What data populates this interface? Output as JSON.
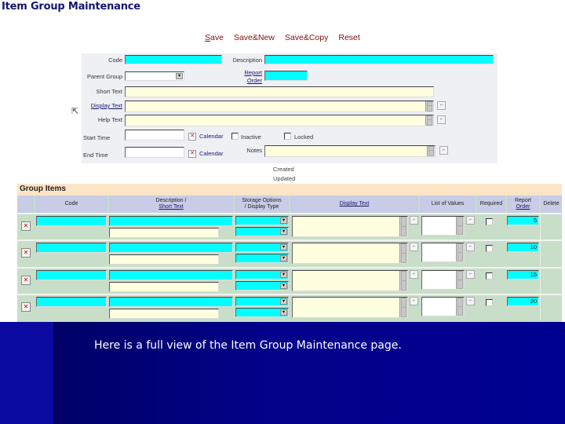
{
  "page": {
    "title": "Item Group Maintenance"
  },
  "toolbar": {
    "save": "Save",
    "save_new": "Save&New",
    "save_copy": "Save&Copy",
    "reset": "Reset"
  },
  "form": {
    "code_label": "Code",
    "code_value": "",
    "description_label": "Description",
    "description_value": "",
    "parent_group_label": "Parent Group",
    "parent_group_value": "",
    "report_order_label_1": "Report",
    "report_order_label_2": "Order",
    "report_order_value": "",
    "short_text_label": "Short Text",
    "short_text_value": "",
    "display_text_label": "Display Text",
    "display_text_value": "",
    "help_text_label": "Help Text",
    "help_text_value": "",
    "start_time_label": "Start Time",
    "start_time_value": "",
    "end_time_label": "End Time",
    "end_time_value": "",
    "calendar_label": "Calendar",
    "inactive_label": "Inactive",
    "inactive_checked": false,
    "locked_label": "Locked",
    "locked_checked": false,
    "notes_label": "Notes",
    "notes_value": "",
    "created_label": "Created",
    "updated_label": "Updated"
  },
  "group_items": {
    "title": "Group Items",
    "columns": {
      "code": "Code",
      "description_1": "Description /",
      "description_2": "Short Text",
      "storage_1": "Storage Options",
      "storage_2": "/ Display Type",
      "display_text": "Display Text",
      "list_of_values": "List of Values",
      "required": "Required",
      "report_order_1": "Report",
      "report_order_2": "Order",
      "delete": "Delete"
    },
    "rows": [
      {
        "code": "",
        "description": "",
        "short_text": "",
        "display_text": "",
        "list_of_values": "",
        "required": false,
        "report_order": "5"
      },
      {
        "code": "",
        "description": "",
        "short_text": "",
        "display_text": "",
        "list_of_values": "",
        "required": false,
        "report_order": "10"
      },
      {
        "code": "",
        "description": "",
        "short_text": "",
        "display_text": "",
        "list_of_values": "",
        "required": false,
        "report_order": "15"
      },
      {
        "code": "",
        "description": "",
        "short_text": "",
        "display_text": "",
        "list_of_values": "",
        "required": false,
        "report_order": "20"
      }
    ]
  },
  "icons": {
    "delete_row": "✕",
    "dropdown": "▾",
    "calendar": "✕",
    "expand": "⌐",
    "cursor": "⇱"
  },
  "colors": {
    "title": "#16166e",
    "toolbar": "#7a1010",
    "required_field": "#00ffff",
    "text_field": "#ffffe0",
    "group_header": "#fce4c6",
    "grid_header": "#c8cce6",
    "grid_body": "#c8dec8",
    "footer": "#000080"
  },
  "caption": "Here is a full view of the Item Group Maintenance page."
}
